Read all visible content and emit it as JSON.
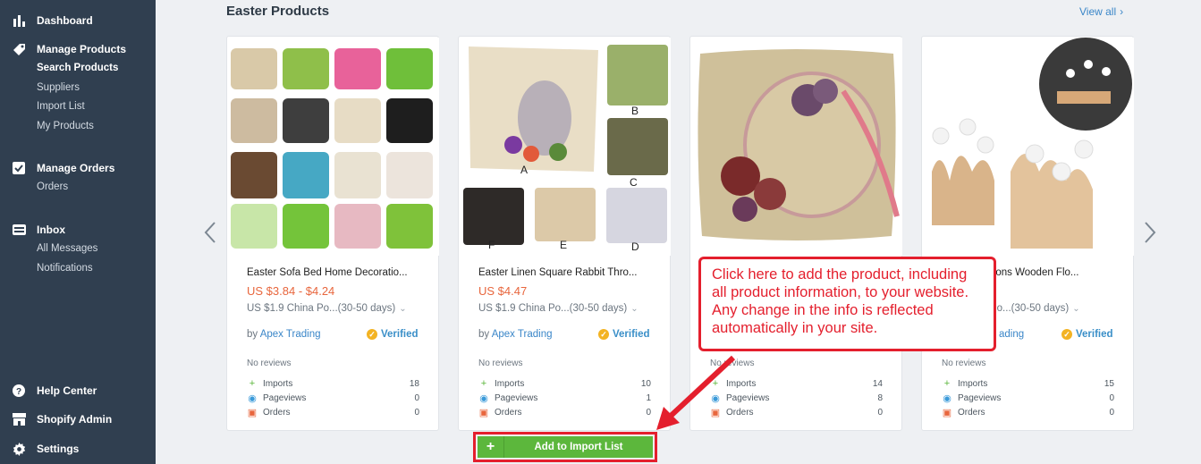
{
  "sidebar": {
    "dashboard": "Dashboard",
    "manage_products": "Manage Products",
    "products_sub": [
      "Search Products",
      "Suppliers",
      "Import List",
      "My Products"
    ],
    "manage_orders": "Manage Orders",
    "orders_sub": [
      "Orders"
    ],
    "inbox": "Inbox",
    "inbox_sub": [
      "All Messages",
      "Notifications"
    ],
    "help_center": "Help Center",
    "shopify_admin": "Shopify Admin",
    "settings": "Settings"
  },
  "section": {
    "title": "Easter Products",
    "view_all": "View all"
  },
  "cards": [
    {
      "title": "Easter Sofa Bed Home Decoratio...",
      "price": "US $3.84 - $4.24",
      "shipping": "US $1.9 China Po...(30-50 days)",
      "by": "by",
      "supplier": "Apex Trading",
      "verified": "Verified",
      "reviews": "No reviews",
      "imports_label": "Imports",
      "imports": "18",
      "pageviews_label": "Pageviews",
      "pageviews": "0",
      "orders_label": "Orders",
      "orders": "0"
    },
    {
      "title": "Easter Linen Square Rabbit Thro...",
      "price": "US $4.47",
      "shipping": "US $1.9 China Po...(30-50 days)",
      "by": "by",
      "supplier": "Apex Trading",
      "verified": "Verified",
      "reviews": "No reviews",
      "imports_label": "Imports",
      "imports": "10",
      "pageviews_label": "Pageviews",
      "pageviews": "1",
      "orders_label": "Orders",
      "orders": "0"
    },
    {
      "title": "",
      "price": "",
      "shipping": "",
      "by": "",
      "supplier": "",
      "verified": "",
      "reviews": "No reviews",
      "imports_label": "Imports",
      "imports": "14",
      "pageviews_label": "Pageviews",
      "pageviews": "8",
      "orders_label": "Orders",
      "orders": "0"
    },
    {
      "title": "orations Wooden Flo...",
      "price": "",
      "shipping": "na Po...(30-50 days)",
      "by": "",
      "supplier": "ading",
      "verified": "Verified",
      "reviews": "No reviews",
      "imports_label": "Imports",
      "imports": "15",
      "pageviews_label": "Pageviews",
      "pageviews": "0",
      "orders_label": "Orders",
      "orders": "0"
    }
  ],
  "add_button": {
    "plus": "+",
    "label": "Add to Import List"
  },
  "callout": {
    "text": "Click here to add the product, including all product information, to your website. Any change in the info is reflected automatically in your site."
  },
  "colors": {
    "sidebar_bg": "#303f50",
    "price": "#e8663d",
    "link": "#3a86c8",
    "button": "#5cb73c",
    "callout": "#e41f2d"
  }
}
